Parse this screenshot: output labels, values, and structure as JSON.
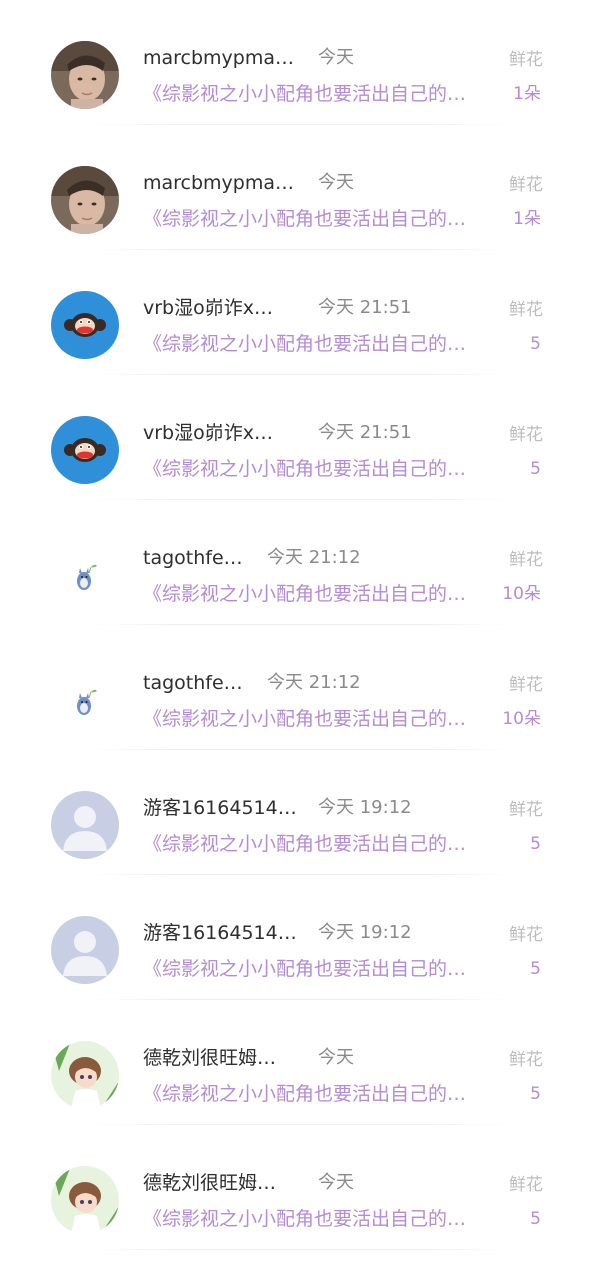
{
  "gift_list": {
    "rows": [
      {
        "name": "marcbmypma…",
        "time": "今天",
        "book": "《综影视之小小配角也要活出自己的…",
        "gift_label": "鲜花",
        "gift_count": "1朵",
        "avatar": "photo-man-avatar"
      },
      {
        "name": "marcbmypma…",
        "time": "今天",
        "book": "《综影视之小小配角也要活出自己的…",
        "gift_label": "鲜花",
        "gift_count": "1朵",
        "avatar": "photo-man-avatar"
      },
      {
        "name": "vrb湿o峁诈x…",
        "time": "今天 21:51",
        "book": "《综影视之小小配角也要活出自己的…",
        "gift_label": "鲜花",
        "gift_count": "5",
        "avatar": "monkey-avatar"
      },
      {
        "name": "vrb湿o峁诈x…",
        "time": "今天 21:51",
        "book": "《综影视之小小配角也要活出自己的…",
        "gift_label": "鲜花",
        "gift_count": "5",
        "avatar": "monkey-avatar"
      },
      {
        "name": "tagothfe…",
        "time": "今天 21:12",
        "book": "《综影视之小小配角也要活出自己的…",
        "gift_label": "鲜花",
        "gift_count": "10朵",
        "avatar": "totoro-avatar"
      },
      {
        "name": "tagothfe…",
        "time": "今天 21:12",
        "book": "《综影视之小小配角也要活出自己的…",
        "gift_label": "鲜花",
        "gift_count": "10朵",
        "avatar": "totoro-avatar"
      },
      {
        "name": "游客16164514…",
        "time": "今天 19:12",
        "book": "《综影视之小小配角也要活出自己的…",
        "gift_label": "鲜花",
        "gift_count": "5",
        "avatar": "default-user-avatar"
      },
      {
        "name": "游客16164514…",
        "time": "今天 19:12",
        "book": "《综影视之小小配角也要活出自己的…",
        "gift_label": "鲜花",
        "gift_count": "5",
        "avatar": "default-user-avatar"
      },
      {
        "name": "德乾刘很旺姆…",
        "time": "今天",
        "book": "《综影视之小小配角也要活出自己的…",
        "gift_label": "鲜花",
        "gift_count": "5",
        "avatar": "anime-girl-avatar"
      },
      {
        "name": "德乾刘很旺姆…",
        "time": "今天",
        "book": "《综影视之小小配角也要活出自己的…",
        "gift_label": "鲜花",
        "gift_count": "5",
        "avatar": "anime-girl-avatar"
      }
    ]
  },
  "colors": {
    "name": "#2e2e2e",
    "time": "#8a8a8a",
    "book": "#b38bd6",
    "gift_label": "#bdbdbd",
    "gift_count": "#b38bd6"
  }
}
